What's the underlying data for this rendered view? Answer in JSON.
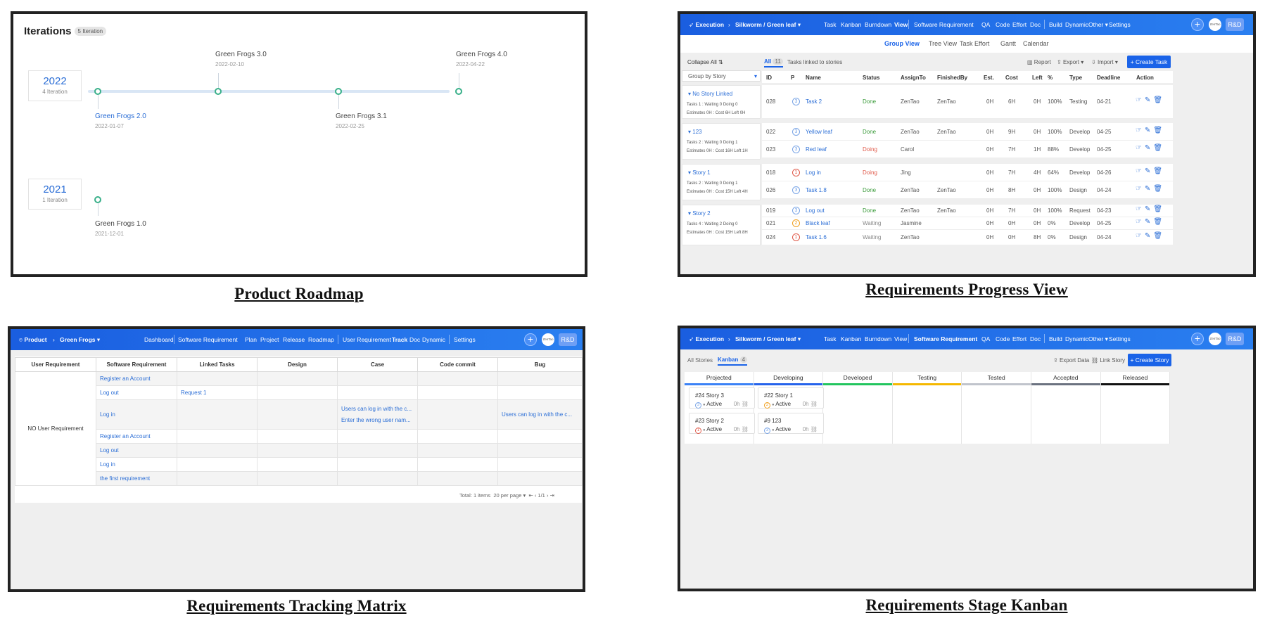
{
  "captions": {
    "roadmap": "Product Roadmap",
    "progress": "Requirements Progress View",
    "matrix": "Requirements Tracking Matrix",
    "kanban": "Requirements Stage Kanban"
  },
  "roadmap": {
    "title": "Iterations",
    "badge": "5 Iteration",
    "years": [
      {
        "year": "2022",
        "count": "4 Iteration"
      },
      {
        "year": "2021",
        "count": "1 Iteration"
      }
    ],
    "milestones": [
      {
        "name": "Green Frogs 2.0",
        "date": "2022-01-07"
      },
      {
        "name": "Green Frogs 3.0",
        "date": "2022-02-10"
      },
      {
        "name": "Green Frogs 3.1",
        "date": "2022-02-25"
      },
      {
        "name": "Green Frogs 4.0",
        "date": "2022-04-22"
      },
      {
        "name": "Green Frogs 1.0",
        "date": "2021-12-01"
      }
    ]
  },
  "progress": {
    "topbar": {
      "module": "Execution",
      "crumb": "Silkworm / Green leaf",
      "nav": [
        "Task",
        "Kanban",
        "Burndown",
        "View",
        "Software Requirement",
        "QA",
        "Code",
        "Effort",
        "Doc",
        "Build",
        "Dynamic",
        "Other",
        "Settings"
      ],
      "active": "View",
      "avatar": "ZenTao",
      "team": "R&D"
    },
    "subnav": [
      "Group View",
      "Tree View",
      "Task Effort",
      "Gantt",
      "Calendar"
    ],
    "collapse_all": "Collapse All",
    "group_by": "Group by Story",
    "tab_all": "All",
    "tab_all_count": "11",
    "tab_linked": "Tasks linked to stories",
    "report": "Report",
    "export": "Export",
    "import": "Import",
    "create_task": "+ Create Task",
    "columns": [
      "ID",
      "P",
      "Name",
      "Status",
      "AssignTo",
      "FinishedBy",
      "Est.",
      "Cost",
      "Left",
      "%",
      "Type",
      "Deadline",
      "Action"
    ],
    "groups": [
      {
        "title": "No Story Linked",
        "tasks_label": "Tasks 1 :",
        "waiting": "Waiting 0",
        "doing": "Doing 0",
        "est_label": "Estimates 0H :",
        "cost": "Cost 6H",
        "left": "Left 0H"
      },
      {
        "title": "123",
        "tasks_label": "Tasks 2 :",
        "waiting": "Waiting 0",
        "doing": "Doing 1",
        "est_label": "Estimates 0H :",
        "cost": "Cost 16H",
        "left": "Left 1H"
      },
      {
        "title": "Story 1",
        "tasks_label": "Tasks 2 :",
        "waiting": "Waiting 0",
        "doing": "Doing 1",
        "est_label": "Estimates 0H :",
        "cost": "Cost 15H",
        "left": "Left 4H"
      },
      {
        "title": "Story 2",
        "tasks_label": "Tasks 4 :",
        "waiting": "Waiting 2",
        "doing": "Doing 0",
        "est_label": "Estimates 0H :",
        "cost": "Cost 15H",
        "left": "Left 8H"
      }
    ],
    "rows": [
      {
        "id": "028",
        "p": "3",
        "name": "Task 2",
        "status": "Done",
        "assign": "ZenTao",
        "finished": "ZenTao",
        "est": "0H",
        "cost": "6H",
        "left": "0H",
        "pct": "100%",
        "type": "Testing",
        "deadline": "04-21"
      },
      {
        "id": "022",
        "p": "3",
        "name": "Yellow leaf",
        "status": "Done",
        "assign": "ZenTao",
        "finished": "ZenTao",
        "est": "0H",
        "cost": "9H",
        "left": "0H",
        "pct": "100%",
        "type": "Develop",
        "deadline": "04-25"
      },
      {
        "id": "023",
        "p": "3",
        "name": "Red leaf",
        "status": "Doing",
        "assign": "Carol",
        "finished": "",
        "est": "0H",
        "cost": "7H",
        "left": "1H",
        "pct": "88%",
        "type": "Develop",
        "deadline": "04-25"
      },
      {
        "id": "018",
        "p": "1",
        "name": "Log in",
        "status": "Doing",
        "assign": "Jing",
        "finished": "",
        "est": "0H",
        "cost": "7H",
        "left": "4H",
        "pct": "64%",
        "type": "Develop",
        "deadline": "04-26"
      },
      {
        "id": "026",
        "p": "3",
        "name": "Task 1.8",
        "status": "Done",
        "assign": "ZenTao",
        "finished": "ZenTao",
        "est": "0H",
        "cost": "8H",
        "left": "0H",
        "pct": "100%",
        "type": "Design",
        "deadline": "04-24"
      },
      {
        "id": "019",
        "p": "3",
        "name": "Log out",
        "status": "Done",
        "assign": "ZenTao",
        "finished": "ZenTao",
        "est": "0H",
        "cost": "7H",
        "left": "0H",
        "pct": "100%",
        "type": "Request",
        "deadline": "04-23"
      },
      {
        "id": "021",
        "p": "2",
        "name": "Black leaf",
        "status": "Waiting",
        "assign": "Jasmine",
        "finished": "",
        "est": "0H",
        "cost": "0H",
        "left": "0H",
        "pct": "0%",
        "type": "Develop",
        "deadline": "04-25"
      },
      {
        "id": "024",
        "p": "1",
        "name": "Task 1.6",
        "status": "Waiting",
        "assign": "ZenTao",
        "finished": "",
        "est": "0H",
        "cost": "0H",
        "left": "8H",
        "pct": "0%",
        "type": "Design",
        "deadline": "04-24"
      }
    ]
  },
  "matrix": {
    "topbar": {
      "module": "Product",
      "crumb": "Green Frogs",
      "nav": [
        "Dashboard",
        "Software Requirement",
        "Plan",
        "Project",
        "Release",
        "Roadmap",
        "User Requirement",
        "Track",
        "Doc",
        "Dynamic",
        "Settings"
      ],
      "active": "Track",
      "avatar": "ZenTao",
      "team": "R&D"
    },
    "columns": [
      "User Requirement",
      "Software Requirement",
      "Linked Tasks",
      "Design",
      "Case",
      "Code commit",
      "Bug"
    ],
    "user_req": "NO User Requirement",
    "rows": [
      {
        "sr": "Register an Account",
        "task": "",
        "case": "",
        "bug": ""
      },
      {
        "sr": "Log out",
        "task": "Request 1",
        "case": "",
        "bug": ""
      },
      {
        "sr": "Log in",
        "task": "",
        "case": "Users can log in with the c...",
        "case2": "Enter the wrong user nam...",
        "bug": "Users can log in with the c..."
      },
      {
        "sr": "Register an Account",
        "task": "",
        "case": "",
        "bug": ""
      },
      {
        "sr": "Log out",
        "task": "",
        "case": "",
        "bug": ""
      },
      {
        "sr": "Log in",
        "task": "",
        "case": "",
        "bug": ""
      },
      {
        "sr": "the first requirement",
        "task": "",
        "case": "",
        "bug": ""
      }
    ],
    "pager": {
      "total": "Total: 1 items",
      "per_page": "20 per page",
      "page": "1/1"
    }
  },
  "kanban": {
    "topbar": {
      "module": "Execution",
      "crumb": "Silkworm / Green leaf",
      "nav": [
        "Task",
        "Kanban",
        "Burndown",
        "View",
        "Software Requirement",
        "QA",
        "Code",
        "Effort",
        "Doc",
        "Build",
        "Dynamic",
        "Other",
        "Settings"
      ],
      "active": "Software Requirement",
      "avatar": "ZenTao",
      "team": "R&D"
    },
    "tab_all": "All Stories",
    "tab_kanban": "Kanban",
    "tab_kanban_count": "4",
    "export": "Export Data",
    "link": "Link Story",
    "create": "+ Create Story",
    "columns": [
      {
        "name": "Projected",
        "color": "#3b82f6"
      },
      {
        "name": "Developing",
        "color": "#2563eb"
      },
      {
        "name": "Developed",
        "color": "#22c55e"
      },
      {
        "name": "Testing",
        "color": "#f5b800"
      },
      {
        "name": "Tested",
        "color": "#c0c4cc"
      },
      {
        "name": "Accepted",
        "color": "#6b7280"
      },
      {
        "name": "Released",
        "color": "#111111"
      }
    ],
    "cards": [
      {
        "title": "#24 Story 3",
        "pri": "3",
        "status": "Active",
        "hours": "0h"
      },
      {
        "title": "#23 Story 2",
        "pri": "1",
        "status": "Active",
        "hours": "0h"
      },
      {
        "title": "#22 Story 1",
        "pri": "2",
        "status": "Active",
        "hours": "0h"
      },
      {
        "title": "#9 123",
        "pri": "3",
        "status": "Active",
        "hours": "0h"
      }
    ]
  }
}
